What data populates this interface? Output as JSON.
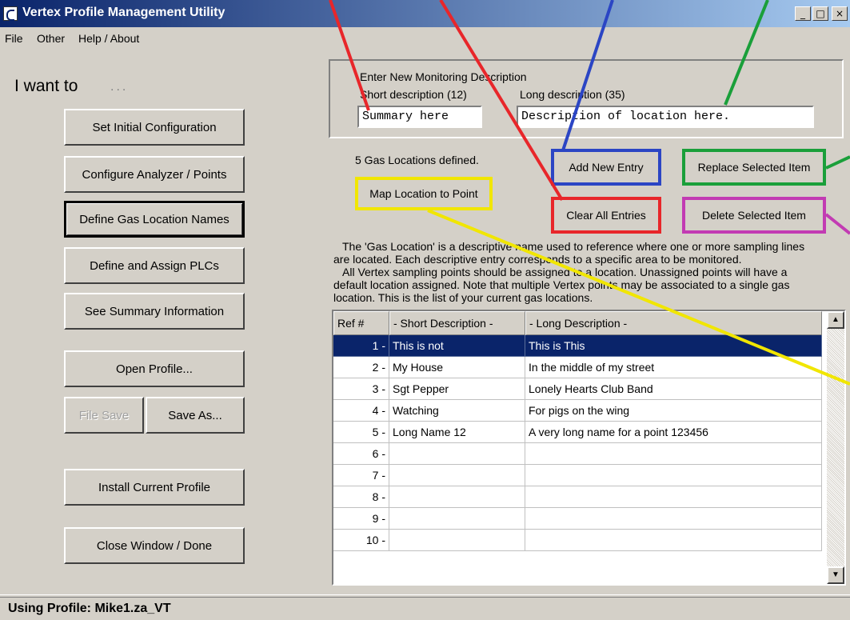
{
  "window": {
    "title": "Vertex Profile Management Utility",
    "minimize": "_",
    "maximize": "□",
    "close": "×"
  },
  "menu": {
    "file": "File",
    "other": "Other",
    "help": "Help / About"
  },
  "left": {
    "heading": "I want to",
    "dots": "...",
    "buttons": {
      "set_config": "Set Initial Configuration",
      "configure": "Configure Analyzer / Points",
      "define_gas": "Define Gas Location Names",
      "define_plc": "Define and Assign PLCs",
      "summary": "See Summary Information",
      "open": "Open Profile...",
      "file_save": "File Save",
      "save_as": "Save As...",
      "install": "Install Current Profile",
      "close": "Close Window / Done"
    }
  },
  "entry": {
    "group_label": "Enter New Monitoring Description",
    "short_label": "Short description (12)",
    "long_label": "Long description (35)",
    "short_value": "Summary here",
    "long_value": "Description of location here."
  },
  "count_text": "5  Gas Locations defined.",
  "actions": {
    "map": "Map Location to Point",
    "add": "Add New Entry",
    "replace": "Replace Selected Item",
    "clear": "Clear All Entries",
    "delete": "Delete Selected Item"
  },
  "help_text": {
    "line1": "The 'Gas Location' is a descriptive name used to reference where one or more sampling lines",
    "line2": "are located.  Each descriptive entry corresponds to a specific area to be monitored.",
    "line3": "All Vertex sampling points should be assigned to a location. Unassigned points will have a",
    "line4": "default location assigned. Note that multiple Vertex points may be associated to a single gas",
    "line5": "location.  This is the list of your current gas locations."
  },
  "table": {
    "headers": [
      "Ref #",
      "- Short Description -",
      "- Long Description -"
    ],
    "rows": [
      [
        "1 -",
        "This is not",
        "This is This"
      ],
      [
        "2 -",
        "My House",
        "In the middle of my street"
      ],
      [
        "3 -",
        "Sgt Pepper",
        "Lonely Hearts Club Band"
      ],
      [
        "4 -",
        "Watching",
        "For pigs on the wing"
      ],
      [
        "5 -",
        "Long Name 12",
        "A very long name for a point 123456"
      ],
      [
        "6 -",
        "",
        ""
      ],
      [
        "7 -",
        "",
        ""
      ],
      [
        "8 -",
        "",
        ""
      ],
      [
        "9 -",
        "",
        ""
      ],
      [
        "10 -",
        "",
        ""
      ]
    ],
    "selected_index": 0
  },
  "status": "Using Profile:  Mike1.za_VT",
  "colors": {
    "red": "#e8262a",
    "blue": "#2b45c4",
    "green": "#1a9f3a",
    "magenta": "#c23bb3",
    "yellow": "#f1e600",
    "selection": "#0a246a"
  }
}
